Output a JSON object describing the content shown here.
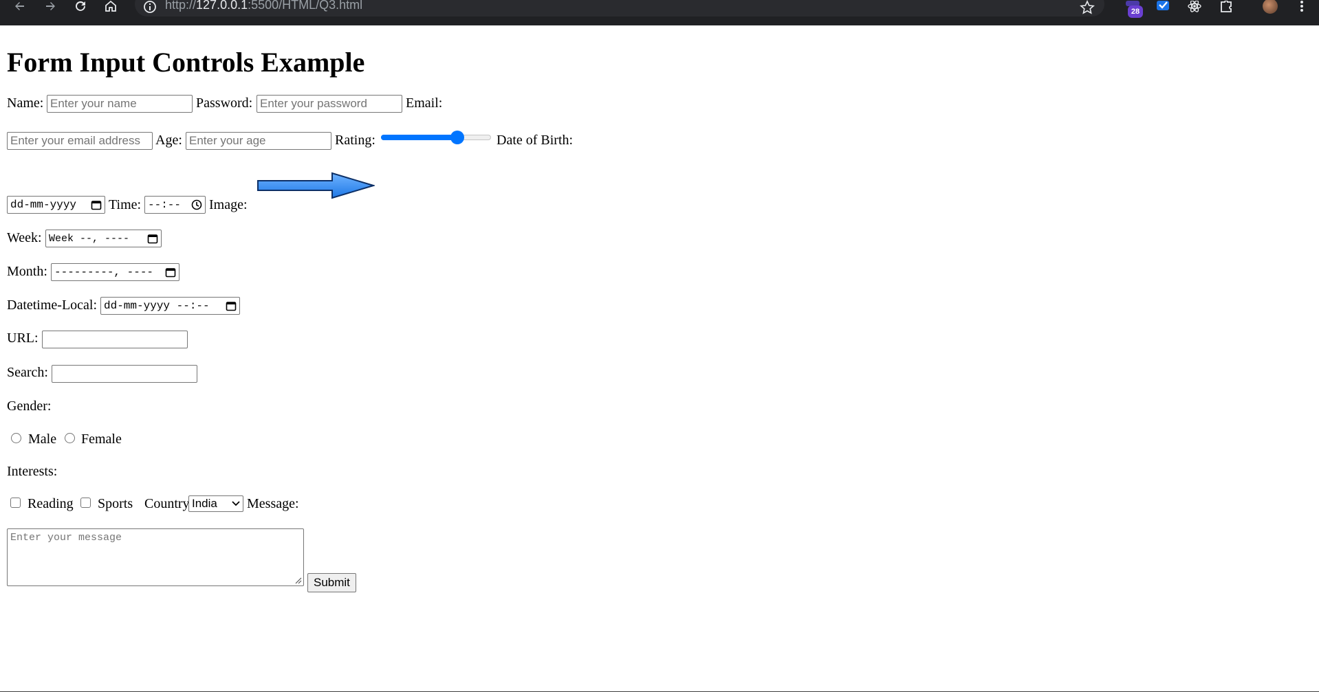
{
  "browser": {
    "url_prefix": "http://",
    "url_host": "127.0.0.1",
    "url_rest": ":5500/HTML/Q3.html",
    "extension_badge": "28",
    "icons": [
      "back-arrow-icon",
      "forward-arrow-icon",
      "reload-icon",
      "home-icon",
      "info-icon",
      "star-icon",
      "extension-badge-icon",
      "checkmark-extension-icon",
      "react-atom-icon",
      "puzzle-piece-icon",
      "avatar",
      "kebab-menu-icon"
    ]
  },
  "page": {
    "title": "Form Input Controls Example"
  },
  "form": {
    "name_label": "Name:",
    "name_placeholder": "Enter your name",
    "password_label": "Password:",
    "password_placeholder": "Enter your password",
    "email_label": "Email:",
    "email_placeholder": "Enter your email address",
    "age_label": "Age:",
    "age_placeholder": "Enter your age",
    "rating_label": "Rating:",
    "rating_value": 0.72,
    "dob_label": "Date of Birth:",
    "dob_display": "dd-mm-yyyy",
    "time_label": "Time:",
    "time_display": "--:--",
    "image_label": "Image:",
    "image_icon": "blue-arrow-icon",
    "week_label": "Week:",
    "week_display": "Week --, ----",
    "month_label": "Month:",
    "month_display": "---------, ----",
    "datetime_label": "Datetime-Local:",
    "datetime_display": "dd-mm-yyyy --:--",
    "url_label": "URL:",
    "search_label": "Search:",
    "gender_label": "Gender:",
    "gender_options": [
      "Male",
      "Female"
    ],
    "interests_label": "Interests:",
    "interest_options": [
      "Reading",
      "Sports"
    ],
    "country_label": "Country:",
    "country_selected": "India",
    "message_label": "Message:",
    "message_placeholder": "Enter your message",
    "submit_label": "Submit"
  }
}
